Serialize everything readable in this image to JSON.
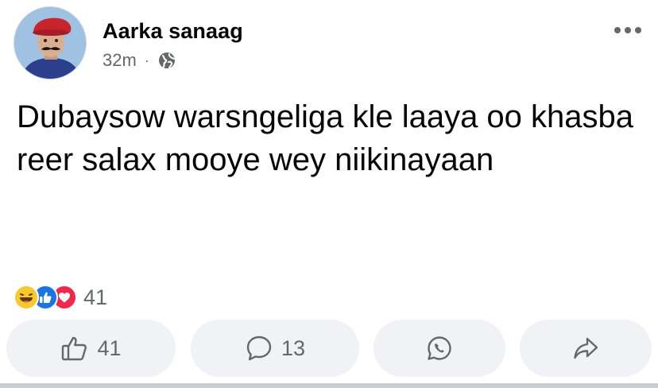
{
  "post": {
    "author": "Aarka sanaag",
    "time": "32m",
    "separator": "·",
    "privacy_icon": "globe-icon",
    "more_icon": "more-dots-icon",
    "text": "Dubaysow warsngeliga kle laaya oo khasba reer salax mooye wey niikinayaan"
  },
  "reactions": {
    "icons": [
      "haha-reaction-icon",
      "like-reaction-icon",
      "love-reaction-icon"
    ],
    "count": "41"
  },
  "actions": {
    "like_icon": "thumbs-up-icon",
    "like_count": "41",
    "comment_icon": "comment-icon",
    "comment_count": "13",
    "whatsapp_icon": "whatsapp-icon",
    "share_icon": "share-icon"
  },
  "colors": {
    "text": "#050505",
    "secondary": "#65676b",
    "button_bg": "#f0f2f5",
    "like_blue": "#1b74e4",
    "love_red": "#f02849",
    "haha_yellow": "#f7c92f"
  }
}
